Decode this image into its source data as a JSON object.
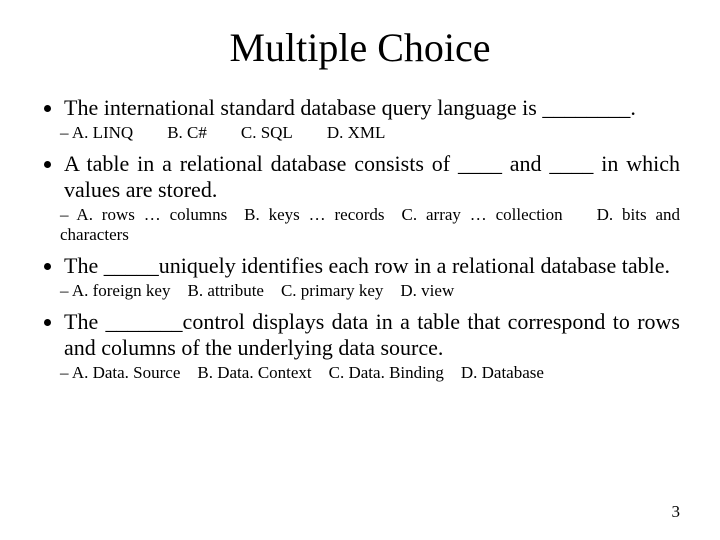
{
  "title": "Multiple Choice",
  "q1": "The international standard database query language is ________.",
  "q1opts": "A. LINQ  B. C#  C. SQL  D. XML",
  "q2": "A table in a relational database consists of ____ and ____ in which values are stored.",
  "q2opts": "A. rows … columns B. keys … records C. array … collection  D. bits and characters",
  "q3": "The _____uniquely identifies each row in a relational database table.",
  "q3opts": "A. foreign key B. attribute C. primary key D. view",
  "q4": "The _______control displays data in a table that correspond to rows and columns of the underlying data source.",
  "q4opts": "A. Data. Source B. Data. Context C. Data. Binding D. Database",
  "page": "3"
}
